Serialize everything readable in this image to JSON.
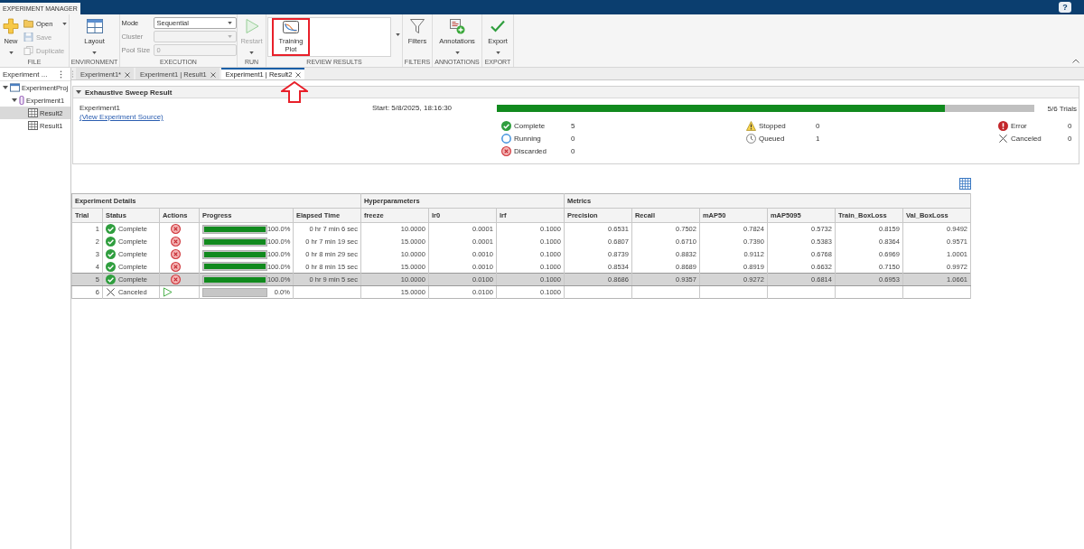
{
  "app_bar": {
    "tab": "EXPERIMENT MANAGER",
    "help": "?"
  },
  "toolstrip": {
    "file": {
      "label": "FILE",
      "new": {
        "label": "New",
        "disabled": false
      },
      "open": {
        "label": "Open",
        "disabled": false
      },
      "save": {
        "label": "Save",
        "disabled": true
      },
      "duplicate": {
        "label": "Duplicate",
        "disabled": true
      }
    },
    "environment": {
      "label": "ENVIRONMENT",
      "layout": {
        "label": "Layout"
      }
    },
    "execution": {
      "label": "EXECUTION",
      "mode": {
        "label": "Mode",
        "value": "Sequential",
        "disabled": false
      },
      "cluster": {
        "label": "Cluster",
        "disabled": true
      },
      "pool_size": {
        "label": "Pool Size",
        "value": "0",
        "disabled": true
      }
    },
    "run": {
      "label": "RUN",
      "restart": {
        "label": "Restart",
        "disabled": true
      }
    },
    "review_results": {
      "label": "REVIEW RESULTS",
      "gallery": [
        {
          "label": "Training Plot",
          "callout": true
        }
      ]
    },
    "filters": {
      "label": "FILTERS",
      "filters": {
        "label": "Filters"
      }
    },
    "annotations": {
      "label": "ANNOTATIONS",
      "annotations": {
        "label": "Annotations"
      }
    },
    "export": {
      "label": "EXPORT",
      "export": {
        "label": "Export"
      }
    }
  },
  "browser": {
    "title": "Experiment ...",
    "tree": [
      {
        "label": "ExperimentProj",
        "expanded": true,
        "selected": false,
        "children": [
          {
            "label": "Experiment1",
            "expanded": true,
            "selected": false,
            "children": [
              {
                "label": "Result2",
                "selected": true
              },
              {
                "label": "Result1",
                "selected": false
              }
            ]
          }
        ]
      }
    ]
  },
  "document_tabs": [
    {
      "label": "Experiment1*",
      "selected": false
    },
    {
      "label": "Experiment1 | Result1",
      "selected": false
    },
    {
      "label": "Experiment1 | Result2",
      "selected": true
    }
  ],
  "summary": {
    "title": "Exhaustive Sweep Result",
    "expanded": true,
    "experiment": "Experiment1",
    "source_link": "(View Experiment Source)",
    "start": "Start: 5/8/2025, 18:16:30",
    "progress": {
      "level": 0.833,
      "reading": "5/6 Trials"
    },
    "status_columns": [
      {
        "items": [
          {
            "kind": "complete",
            "label": "Complete",
            "count": "5"
          },
          {
            "kind": "running",
            "label": "Running",
            "count": "0"
          },
          {
            "kind": "discarded",
            "label": "Discarded",
            "count": "0"
          }
        ]
      },
      {
        "items": [
          {
            "kind": "stopped",
            "label": "Stopped",
            "count": "0"
          },
          {
            "kind": "queued",
            "label": "Queued",
            "count": "1"
          }
        ]
      },
      {
        "items": [
          {
            "kind": "error",
            "label": "Error",
            "count": "0"
          },
          {
            "kind": "canceled",
            "label": "Canceled",
            "count": "0"
          }
        ]
      }
    ]
  },
  "table": {
    "groups": [
      {
        "label": "Experiment Details",
        "columns": [
          "Trial",
          "Status",
          "Actions",
          "Progress",
          "Elapsed Time"
        ]
      },
      {
        "label": "Hyperparameters",
        "columns": [
          "freeze",
          "lr0",
          "lrf"
        ]
      },
      {
        "label": "Metrics",
        "columns": [
          "Precision",
          "Recall",
          "mAP50",
          "mAP5095",
          "Train_BoxLoss",
          "Val_BoxLoss"
        ]
      }
    ],
    "rows": [
      {
        "selected": false,
        "trial": "1",
        "status": {
          "kind": "complete",
          "label": "Complete"
        },
        "action": {
          "kind": "discard"
        },
        "progress": {
          "level": 1,
          "reading": "100.0%"
        },
        "elapsed": "0 hr 7 min 6 sec",
        "hyperparameters": [
          "10.0000",
          "0.0001",
          "0.1000"
        ],
        "metrics": [
          "0.6531",
          "0.7502",
          "0.7824",
          "0.5732",
          "0.8159",
          "0.9492"
        ]
      },
      {
        "selected": false,
        "trial": "2",
        "status": {
          "kind": "complete",
          "label": "Complete"
        },
        "action": {
          "kind": "discard"
        },
        "progress": {
          "level": 1,
          "reading": "100.0%"
        },
        "elapsed": "0 hr 7 min 19 sec",
        "hyperparameters": [
          "15.0000",
          "0.0001",
          "0.1000"
        ],
        "metrics": [
          "0.6807",
          "0.6710",
          "0.7390",
          "0.5383",
          "0.8364",
          "0.9571"
        ]
      },
      {
        "selected": false,
        "trial": "3",
        "status": {
          "kind": "complete",
          "label": "Complete"
        },
        "action": {
          "kind": "discard"
        },
        "progress": {
          "level": 1,
          "reading": "100.0%"
        },
        "elapsed": "0 hr 8 min 29 sec",
        "hyperparameters": [
          "10.0000",
          "0.0010",
          "0.1000"
        ],
        "metrics": [
          "0.8739",
          "0.8832",
          "0.9112",
          "0.6768",
          "0.6969",
          "1.0001"
        ]
      },
      {
        "selected": false,
        "trial": "4",
        "status": {
          "kind": "complete",
          "label": "Complete"
        },
        "action": {
          "kind": "discard"
        },
        "progress": {
          "level": 1,
          "reading": "100.0%"
        },
        "elapsed": "0 hr 8 min 15 sec",
        "hyperparameters": [
          "15.0000",
          "0.0010",
          "0.1000"
        ],
        "metrics": [
          "0.8534",
          "0.8689",
          "0.8919",
          "0.6632",
          "0.7150",
          "0.9972"
        ]
      },
      {
        "selected": true,
        "trial": "5",
        "status": {
          "kind": "complete",
          "label": "Complete"
        },
        "action": {
          "kind": "discard"
        },
        "progress": {
          "level": 1,
          "reading": "100.0%"
        },
        "elapsed": "0 hr 9 min 5 sec",
        "hyperparameters": [
          "10.0000",
          "0.0100",
          "0.1000"
        ],
        "metrics": [
          "0.8686",
          "0.9357",
          "0.9272",
          "0.6814",
          "0.6953",
          "1.0661"
        ]
      },
      {
        "selected": false,
        "trial": "6",
        "status": {
          "kind": "canceled",
          "label": "Canceled"
        },
        "action": {
          "kind": "restart"
        },
        "progress": {
          "level": 0,
          "reading": "0.0%"
        },
        "hyperparameters": [
          "15.0000",
          "0.0100",
          "0.1000"
        ]
      }
    ]
  }
}
